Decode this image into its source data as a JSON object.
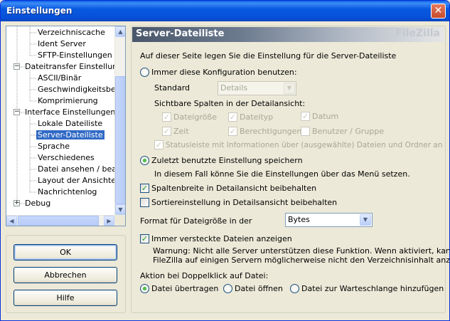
{
  "window": {
    "title": "Einstellungen"
  },
  "tree": {
    "items": [
      {
        "label": "Verzeichniscache"
      },
      {
        "label": "Ident Server"
      },
      {
        "label": "SFTP-Einstellungen"
      },
      {
        "label": "Dateitransfer Einstellungen"
      },
      {
        "label": "ASCII/Binär"
      },
      {
        "label": "Geschwindigkeitsbegrenzung"
      },
      {
        "label": "Komprimierung"
      },
      {
        "label": "Interface Einstellungen"
      },
      {
        "label": "Lokale Dateiliste"
      },
      {
        "label": "Server-Dateiliste"
      },
      {
        "label": "Sprache"
      },
      {
        "label": "Verschiedenes"
      },
      {
        "label": "Datei ansehen / bearbeiten"
      },
      {
        "label": "Layout der Ansichten"
      },
      {
        "label": "Nachrichtenlog"
      },
      {
        "label": "Debug"
      }
    ],
    "selected": "Server-Dateiliste"
  },
  "buttons": {
    "ok": "OK",
    "cancel": "Abbrechen",
    "help": "Hilfe"
  },
  "panel": {
    "title": "Server-Dateiliste",
    "brand": "FileZilla",
    "intro": "Auf dieser Seite legen Sie die Einstellung für die Server-Dateiliste",
    "radio_always": "Immer diese Konfiguration benutzen:",
    "standard_label": "Standard",
    "standard_value": "Details",
    "columns_label": "Sichtbare Spalten in der Detailansicht:",
    "col_size": "Dateigröße",
    "col_type": "Dateityp",
    "col_date": "Datum",
    "col_time": "Zeit",
    "col_perms": "Berechtigungen",
    "col_owner": "Benutzer / Gruppe",
    "statusbar": "Statusleiste mit Informationen über (ausgewählte) Dateien und Ordner anzeigen",
    "radio_last": "Zuletzt benutzte Einstellung speichern",
    "last_note": "In diesem Fall könne Sie die Einstellungen über das Menü setzen.",
    "chk_colwidth": "Spaltenbreite in Detailansicht beibehalten",
    "chk_sort": "Sortiereinstellung in Detailsansicht beibehalten",
    "size_format_label": "Format für Dateigröße in der",
    "size_format_value": "Bytes",
    "chk_hidden": "Immer versteckte Dateien anzeigen",
    "warning_1": "Warnung: Nicht alle Server unterstützen diese Funktion. Wenn aktiviert, kann",
    "warning_2": "FileZilla auf einigen Servern möglicherweise nicht den Verzeichnisinhalt anzeigen.",
    "dblclick_label": "Aktion bei Doppelklick auf Datei:",
    "dbl_transfer": "Datei übertragen",
    "dbl_open": "Datei öffnen",
    "dbl_queue": "Datei zur Warteschlange hinzufügen"
  },
  "colors": {
    "selection": "#316ac5",
    "titlebar": "#0859e0"
  }
}
